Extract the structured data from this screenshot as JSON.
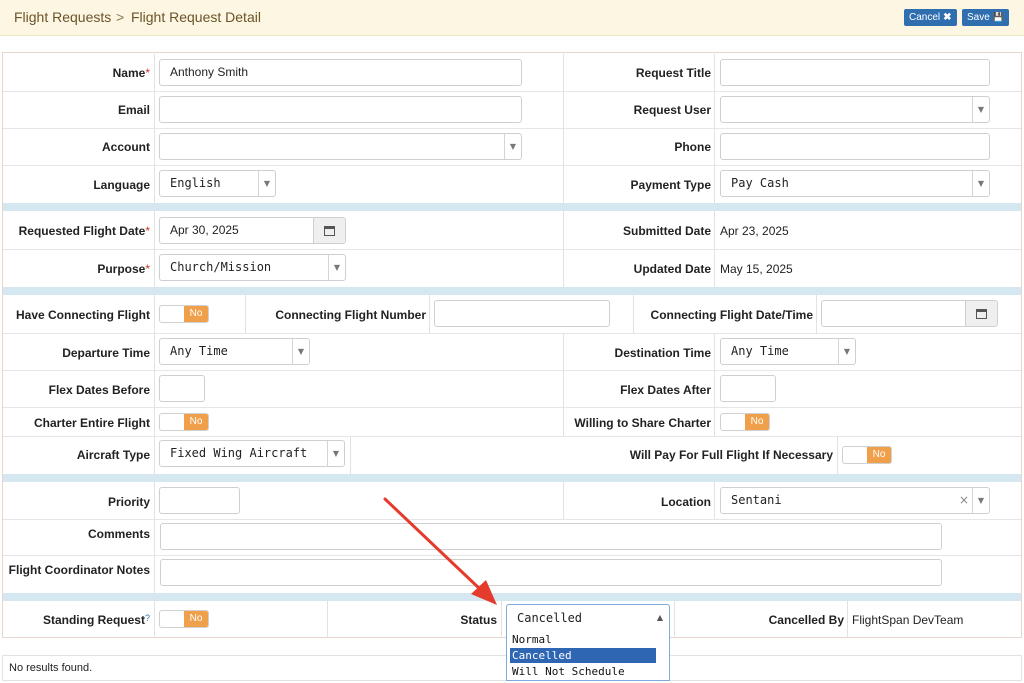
{
  "breadcrumb": {
    "parent": "Flight Requests",
    "separator": ">",
    "current": "Flight Request Detail"
  },
  "header_buttons": {
    "cancel": "Cancel",
    "cancel_icon": "✖",
    "save": "Save",
    "save_icon": "💾"
  },
  "fields": {
    "name": {
      "label": "Name",
      "value": "Anthony Smith",
      "required": "*"
    },
    "request_title": {
      "label": "Request Title",
      "value": ""
    },
    "email": {
      "label": "Email",
      "value": ""
    },
    "request_user": {
      "label": "Request User",
      "value": ""
    },
    "account": {
      "label": "Account",
      "value": ""
    },
    "phone": {
      "label": "Phone",
      "value": ""
    },
    "language": {
      "label": "Language",
      "value": "English"
    },
    "payment_type": {
      "label": "Payment Type",
      "value": "Pay Cash"
    },
    "requested_flight_date": {
      "label": "Requested Flight Date",
      "value": "Apr 30, 2025",
      "required": "*"
    },
    "submitted_date": {
      "label": "Submitted Date",
      "value": "Apr 23, 2025"
    },
    "purpose": {
      "label": "Purpose",
      "value": "Church/Mission",
      "required": "*"
    },
    "updated_date": {
      "label": "Updated Date",
      "value": "May 15, 2025"
    },
    "have_connecting_flight": {
      "label": "Have Connecting Flight",
      "value": "No"
    },
    "connecting_flight_number": {
      "label": "Connecting Flight Number",
      "value": ""
    },
    "connecting_flight_datetime": {
      "label": "Connecting Flight Date/Time",
      "value": ""
    },
    "departure_time": {
      "label": "Departure Time",
      "value": "Any Time"
    },
    "destination_time": {
      "label": "Destination Time",
      "value": "Any Time"
    },
    "flex_dates_before": {
      "label": "Flex Dates Before",
      "value": ""
    },
    "flex_dates_after": {
      "label": "Flex Dates After",
      "value": ""
    },
    "charter_entire_flight": {
      "label": "Charter Entire Flight",
      "value": "No"
    },
    "willing_to_share_charter": {
      "label": "Willing to Share Charter",
      "value": "No"
    },
    "aircraft_type": {
      "label": "Aircraft Type",
      "value": "Fixed Wing Aircraft"
    },
    "will_pay_full_flight": {
      "label": "Will Pay For Full Flight If Necessary",
      "value": "No"
    },
    "priority": {
      "label": "Priority",
      "value": ""
    },
    "location": {
      "label": "Location",
      "value": "Sentani"
    },
    "comments": {
      "label": "Comments",
      "value": ""
    },
    "flight_coordinator_notes": {
      "label": "Flight Coordinator Notes",
      "value": ""
    },
    "standing_request": {
      "label": "Standing Request",
      "help": "?",
      "value": "No"
    },
    "status": {
      "label": "Status",
      "value": "Cancelled",
      "options": [
        "Normal",
        "Cancelled",
        "Will Not Schedule"
      ]
    },
    "cancelled_by": {
      "label": "Cancelled By",
      "value": "FlightSpan DevTeam"
    }
  },
  "footer": {
    "no_results": "No results found."
  },
  "colors": {
    "accent": "#2f6fb0",
    "toggle": "#f0a04b",
    "band": "#d5e7f1",
    "header": "#fdf6e2",
    "annotation_arrow": "#e53b2c"
  }
}
